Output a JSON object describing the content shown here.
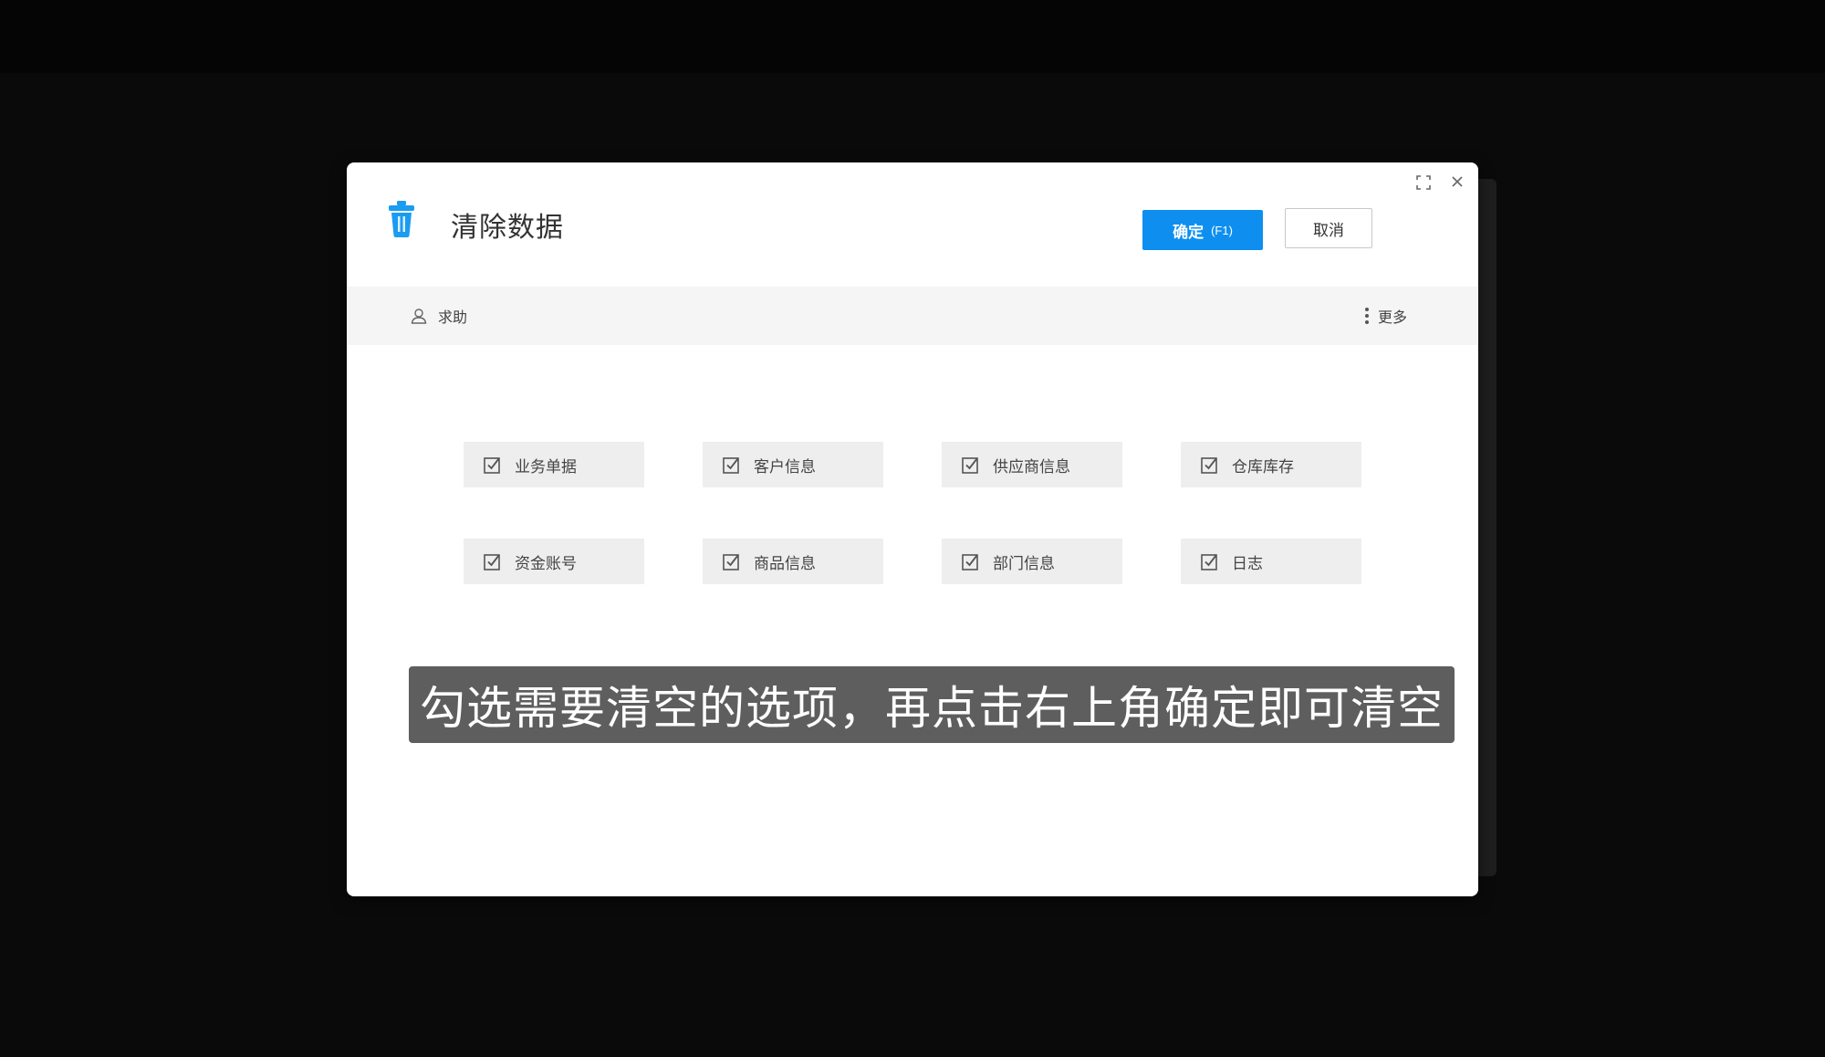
{
  "dialog": {
    "title": "清除数据",
    "confirm_label": "确定",
    "confirm_hint": "(F1)",
    "cancel_label": "取消"
  },
  "toolbar": {
    "help_label": "求助",
    "more_label": "更多"
  },
  "options": [
    {
      "label": "业务单据",
      "checked": true
    },
    {
      "label": "客户信息",
      "checked": true
    },
    {
      "label": "供应商信息",
      "checked": true
    },
    {
      "label": "仓库库存",
      "checked": true
    },
    {
      "label": "资金账号",
      "checked": true
    },
    {
      "label": "商品信息",
      "checked": true
    },
    {
      "label": "部门信息",
      "checked": true
    },
    {
      "label": "日志",
      "checked": true
    }
  ],
  "caption": "勾选需要清空的选项，再点击右上角确定即可清空",
  "colors": {
    "accent": "#0e8ff0",
    "trash": "#1a9cf0",
    "option_bg": "#eeeeee",
    "toolbar_bg": "#f5f5f5"
  },
  "icons": {
    "title": "trash-icon",
    "help": "user-icon",
    "more": "vertical-dots-icon",
    "maximize": "maximize-icon",
    "close": "close-icon",
    "option": "checkbox-checked-icon"
  }
}
